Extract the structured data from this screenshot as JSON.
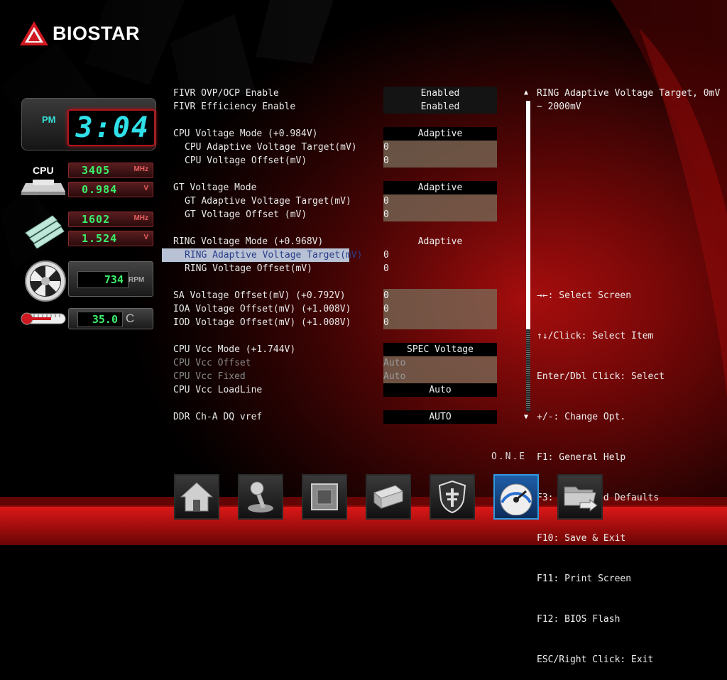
{
  "brand": {
    "name": "BIOSTAR"
  },
  "status": {
    "clock": {
      "ampm": "PM",
      "time": "3:04"
    },
    "cpu": {
      "label": "CPU",
      "freq": "3405",
      "freq_unit": "MHz",
      "voltage": "0.984",
      "voltage_unit": "V"
    },
    "memory": {
      "freq": "1602",
      "freq_unit": "MHz",
      "voltage": "1.524",
      "voltage_unit": "V"
    },
    "fan": {
      "rpm": "734",
      "unit": "RPM"
    },
    "temperature": {
      "value": "35.0",
      "unit": "C"
    }
  },
  "settings": {
    "fivr_ovp_ocp": {
      "label": "FIVR OVP/OCP Enable",
      "value": "Enabled"
    },
    "fivr_efficiency": {
      "label": "FIVR Efficiency Enable",
      "value": "Enabled"
    },
    "cpu_voltage_mode": {
      "label": "CPU Voltage Mode (+0.984V)",
      "value": "Adaptive"
    },
    "cpu_adaptive_target": {
      "label": "CPU Adaptive Voltage Target(mV)",
      "value": "0"
    },
    "cpu_voltage_offset": {
      "label": "CPU Voltage Offset(mV)",
      "value": "0"
    },
    "gt_voltage_mode": {
      "label": "GT Voltage Mode",
      "value": "Adaptive"
    },
    "gt_adaptive_target": {
      "label": "GT Adaptive Voltage Target(mV)",
      "value": "0"
    },
    "gt_voltage_offset": {
      "label": "GT Voltage Offset (mV)",
      "value": "0"
    },
    "ring_voltage_mode": {
      "label": "RING Voltage Mode (+0.968V)",
      "value": "Adaptive"
    },
    "ring_adaptive_target": {
      "label": "RING Adaptive Voltage Target(mV)",
      "value": "0"
    },
    "ring_voltage_offset": {
      "label": "RING Voltage Offset(mV)",
      "value": "0"
    },
    "sa_voltage_offset": {
      "label": "SA Voltage Offset(mV) (+0.792V)",
      "value": "0"
    },
    "ioa_voltage_offset": {
      "label": "IOA Voltage Offset(mV) (+1.008V)",
      "value": "0"
    },
    "iod_voltage_offset": {
      "label": "IOD Voltage Offset(mV) (+1.008V)",
      "value": "0"
    },
    "cpu_vcc_mode": {
      "label": "CPU Vcc Mode (+1.744V)",
      "value": "SPEC Voltage"
    },
    "cpu_vcc_offset": {
      "label": "CPU Vcc Offset",
      "value": "Auto"
    },
    "cpu_vcc_fixed": {
      "label": "CPU Vcc Fixed",
      "value": "Auto"
    },
    "cpu_vcc_loadline": {
      "label": "CPU Vcc LoadLine",
      "value": "Auto"
    },
    "ddr_cha_dq_vref": {
      "label": "DDR Ch-A DQ vref",
      "value": "AUTO"
    }
  },
  "help": {
    "description": "RING Adaptive Voltage Target, 0mV ~ 2000mV",
    "keys": [
      "→←: Select Screen",
      "↑↓/Click: Select Item",
      "Enter/Dbl Click: Select",
      "+/-: Change Opt.",
      "F1: General Help",
      "F3: Optimized Defaults",
      "F10: Save & Exit",
      "F11: Print Screen",
      "F12: BIOS Flash",
      "ESC/Right Click: Exit"
    ]
  },
  "scrollbar": {
    "up": "▲",
    "down": "▼"
  },
  "dock": {
    "active_label": "O.N.E",
    "items": [
      "home-icon",
      "joystick-icon",
      "chip-icon",
      "drive-icon",
      "shield-icon",
      "speedometer-icon",
      "folder-exit-icon"
    ]
  },
  "colors": {
    "accent": "#b0141a",
    "lcd": "#2fe0e8",
    "readout": "#3cf06a",
    "highlight": "#b8c2d4"
  }
}
